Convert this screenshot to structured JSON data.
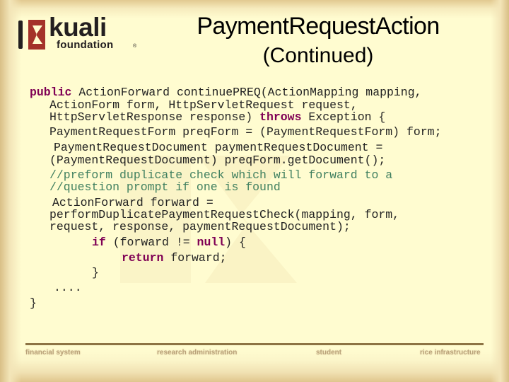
{
  "logo": {
    "name": "kuali",
    "subtitle": "foundation",
    "registered": "®"
  },
  "slide": {
    "title": "PaymentRequestAction",
    "subtitle": "(Continued)"
  },
  "code": {
    "lines": [
      [
        {
          "t": "public",
          "k": "kw"
        },
        {
          "t": " ActionForward continuePREQ(ActionMapping mapping,"
        }
      ],
      [
        {
          "t": "ActionForm form, HttpServletRequest request,"
        }
      ],
      [
        {
          "t": "HttpServletResponse response) "
        },
        {
          "t": "throws",
          "k": "kw"
        },
        {
          "t": " Exception {"
        }
      ],
      [
        {
          "t": "PaymentRequestForm preqForm = (PaymentRequestForm) form;"
        }
      ],
      [
        {
          "t": "PaymentRequestDocument paymentRequestDocument ="
        }
      ],
      [
        {
          "t": "(PaymentRequestDocument) preqForm.getDocument();"
        }
      ],
      [
        {
          "t": "//preform duplicate check which will forward to a",
          "k": "cm"
        }
      ],
      [
        {
          "t": "//question prompt if one is found",
          "k": "cm"
        }
      ],
      [
        {
          "t": "ActionForward forward ="
        }
      ],
      [
        {
          "t": "performDuplicatePaymentRequestCheck(mapping, form,"
        }
      ],
      [
        {
          "t": "request, response, paymentRequestDocument);"
        }
      ],
      [
        {
          "t": "if",
          "k": "kw"
        },
        {
          "t": " (forward != "
        },
        {
          "t": "null",
          "k": "kw"
        },
        {
          "t": ") {"
        }
      ],
      [
        {
          "t": "return",
          "k": "kw"
        },
        {
          "t": " forward;"
        }
      ],
      [
        {
          "t": "}"
        }
      ],
      [
        {
          "t": "...."
        }
      ],
      [
        {
          "t": "}"
        }
      ]
    ]
  },
  "footer": {
    "items": [
      "financial system",
      "research administration",
      "student",
      "rice infrastructure"
    ]
  },
  "colors": {
    "keyword": "#7f0055",
    "comment": "#3f7f5f",
    "logo_red": "#a4322a",
    "footer_rule": "#8d7444"
  }
}
